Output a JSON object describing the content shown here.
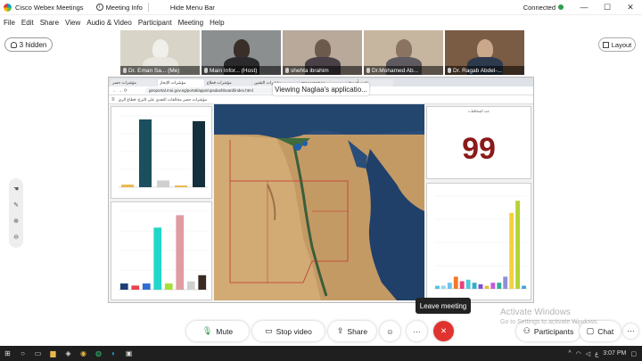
{
  "titlebar": {
    "app": "Cisco Webex Meetings",
    "meeting_info": "Meeting Info",
    "hide_menu": "Hide Menu Bar",
    "status": "Connected",
    "minimize": "—",
    "maximize": "☐",
    "close": "✕"
  },
  "menu": [
    "File",
    "Edit",
    "Share",
    "View",
    "Audio & Video",
    "Participant",
    "Meeting",
    "Help"
  ],
  "hidden_label": "3 hidden",
  "layout_label": "Layout",
  "participants": [
    {
      "name": "Dr. Eman Sa...  (Me)"
    },
    {
      "name": "Main Infor...  (Host)"
    },
    {
      "name": "shehta ibrahim"
    },
    {
      "name": "Dr.Mohamed Ab..."
    },
    {
      "name": "Dr. Ragab Abdel-..."
    }
  ],
  "share_banner": "Viewing Naglaa's applicatio...",
  "browser": {
    "tabs": [
      "مؤشرات حصر",
      "مؤشرات الإنجاز",
      "مؤشرات قطاع",
      "مؤشرات التقنين",
      "Cisco Webex",
      "تقييم أسبوع"
    ],
    "url": "geoportal.moi.gov.eg/portal/apps/opsdashboard/index.html"
  },
  "dashboard": {
    "title": "مؤشرات حصر مخالفات التعدي على الترع- قطاع الري",
    "big_value_title": "عدد المخالفات",
    "big_value": "99"
  },
  "leave_tooltip": "Leave meeting",
  "controls": {
    "mute": "Mute",
    "stop_video": "Stop video",
    "share": "Share",
    "more": "···",
    "participants": "Participants",
    "chat": "Chat"
  },
  "watermark": {
    "line1": "Activate Windows",
    "line2": "Go to Settings to activate Windows."
  },
  "tray": {
    "lang": "ع",
    "time": "3:07 PM"
  },
  "chart_left_top": {
    "values": [
      3,
      80,
      8,
      2,
      78
    ]
  },
  "chart_left_bottom": {
    "values": [
      3,
      2,
      3,
      30,
      3,
      36,
      4,
      7
    ]
  },
  "chart_right": {
    "values": [
      2,
      2,
      4,
      8,
      5,
      6,
      4,
      3,
      2,
      4,
      4,
      8,
      50,
      58,
      2
    ]
  }
}
